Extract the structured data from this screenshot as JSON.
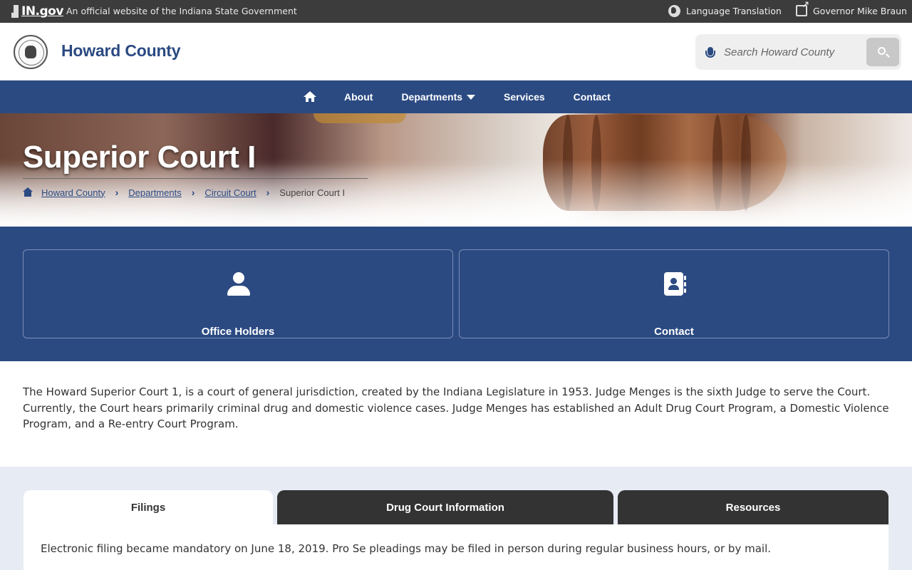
{
  "statebar": {
    "logo_text": "IN.gov",
    "official_text": "An official website of the Indiana State Government",
    "language_label": "Language Translation",
    "governor_label": "Governor Mike Braun"
  },
  "header": {
    "site_title": "Howard County",
    "search_placeholder": "Search Howard County"
  },
  "nav": {
    "items": [
      {
        "label": "About"
      },
      {
        "label": "Departments"
      },
      {
        "label": "Services"
      },
      {
        "label": "Contact"
      }
    ]
  },
  "hero": {
    "title": "Superior Court I",
    "breadcrumb": [
      {
        "label": "Howard County"
      },
      {
        "label": "Departments"
      },
      {
        "label": "Circuit Court"
      },
      {
        "label": "Superior Court I"
      }
    ]
  },
  "cards": [
    {
      "label": "Office Holders",
      "icon": "person-icon"
    },
    {
      "label": "Contact",
      "icon": "address-book-icon"
    }
  ],
  "description": "The Howard Superior Court 1, is a court of general jurisdiction, created by the Indiana Legislature in 1953. Judge Menges is the sixth Judge to serve the Court. Currently, the Court hears primarily criminal drug and domestic violence cases. Judge Menges has established an Adult Drug Court Program, a Domestic Violence Program, and a Re-entry Court Program.",
  "tabs": {
    "items": [
      {
        "label": "Filings",
        "active": true
      },
      {
        "label": "Drug Court Information",
        "active": false
      },
      {
        "label": "Resources",
        "active": false
      }
    ],
    "filings_text": "Electronic filing became mandatory on June 18, 2019. Pro Se pleadings may be filed in person during regular business hours, or by mail."
  },
  "colors": {
    "brand_blue": "#2b4a82",
    "statebar_bg": "#3c3c3c",
    "tab_dark": "#333333",
    "tabs_area_bg": "#e7ebf3"
  }
}
